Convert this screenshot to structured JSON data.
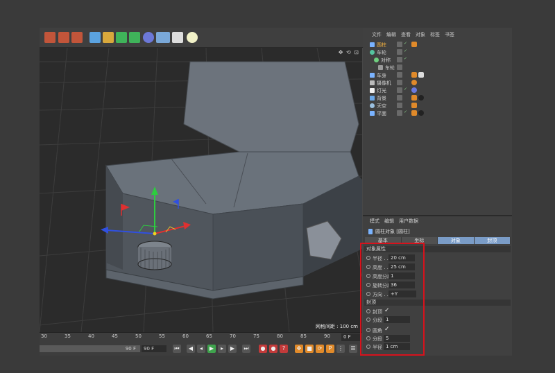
{
  "object_manager": {
    "menu": [
      "文件",
      "编辑",
      "查看",
      "对象",
      "标签",
      "书签"
    ],
    "objects": [
      {
        "name": "圆柱",
        "color": "#7ab3ff",
        "highlight": true
      },
      {
        "name": "车轮",
        "color": "#55c4a0"
      },
      {
        "name": "对称",
        "color": "#6fcf7f"
      },
      {
        "name": "车轮",
        "color": "#9a9a9a"
      },
      {
        "name": "车身",
        "color": "#7ab3ff"
      },
      {
        "name": "摄像机",
        "color": "#bbbbbb"
      },
      {
        "name": "灯光",
        "color": "#f0f0f0"
      },
      {
        "name": "背景",
        "color": "#6aa7e8"
      },
      {
        "name": "天空",
        "color": "#9bc0e0"
      },
      {
        "name": "平面",
        "color": "#7ab3ff"
      }
    ]
  },
  "attributes": {
    "menu": [
      "模式",
      "编辑",
      "用户数据"
    ],
    "title": "圆柱对象 [圆柱]",
    "tabs": [
      "基本",
      "坐标",
      "对象",
      "封顶"
    ],
    "active_tabs": [
      "对象",
      "封顶"
    ],
    "sections": {
      "object": {
        "title": "对象属性",
        "radius": {
          "label": "半径 . . .",
          "value": "20 cm"
        },
        "height": {
          "label": "高度 . . .",
          "value": "25 cm"
        },
        "height_segments": {
          "label": "高度分段",
          "value": "1"
        },
        "rotation_segments": {
          "label": "旋转分段",
          "value": "36"
        },
        "orientation": {
          "label": "方向 . . .",
          "value": "+Y"
        }
      },
      "caps": {
        "title": "封顶",
        "caps": {
          "label": "封顶",
          "checked": "✓"
        },
        "cap_segments": {
          "label": "分段",
          "value": "1"
        },
        "fillet": {
          "label": "圆角",
          "checked": "✓"
        },
        "fillet_segments": {
          "label": "分段",
          "value": "5"
        },
        "fillet_radius": {
          "label": "半径",
          "value": "1 cm"
        }
      }
    }
  },
  "viewport": {
    "grid_spacing": "网格间距 : 100 cm",
    "nav_icons": "✥ ⟲ ⊡"
  },
  "timeline": {
    "ticks": [
      "30",
      "35",
      "40",
      "45",
      "50",
      "55",
      "60",
      "65",
      "70",
      "75",
      "80",
      "85",
      "90"
    ],
    "current_frame": "0 F",
    "end_frame_slider": "90 F",
    "end_frame_field": "90 F"
  },
  "colors": {
    "accent_tab": "#7a9cc7",
    "highlight_box": "#d8121c",
    "axis_y": "#2ecc40",
    "axis_x": "#e03030",
    "axis_z": "#3050e0"
  }
}
